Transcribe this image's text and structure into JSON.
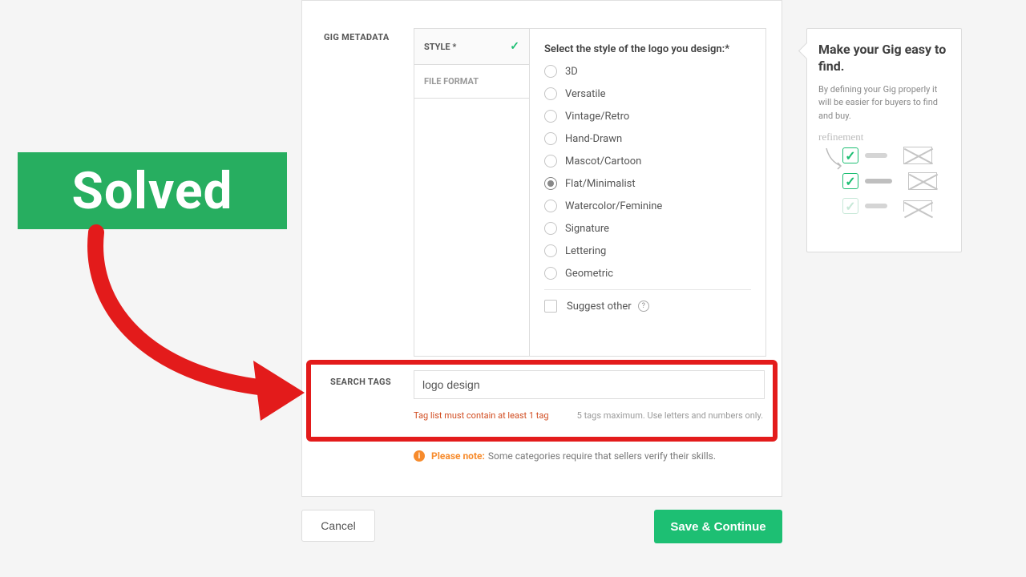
{
  "overlay": {
    "badge": "Solved"
  },
  "sections": {
    "gig_metadata": "GIG METADATA",
    "search_tags": "SEARCH TAGS"
  },
  "metadata": {
    "tabs": {
      "style": "STYLE *",
      "file_format": "FILE FORMAT"
    },
    "prompt": "Select the style of the logo you design:*",
    "options": [
      "3D",
      "Versatile",
      "Vintage/Retro",
      "Hand-Drawn",
      "Mascot/Cartoon",
      "Flat/Minimalist",
      "Watercolor/Feminine",
      "Signature",
      "Lettering",
      "Geometric"
    ],
    "selected_index": 5,
    "suggest_other": "Suggest other"
  },
  "search_tags": {
    "input_value": "logo design",
    "error": "Tag list must contain at least 1 tag",
    "hint": "5 tags maximum. Use letters and numbers only."
  },
  "note": {
    "label": "Please note:",
    "text": "Some categories require that sellers verify their skills."
  },
  "buttons": {
    "cancel": "Cancel",
    "save": "Save & Continue"
  },
  "tip": {
    "title": "Make your Gig easy to find.",
    "body": "By defining your Gig properly it will be easier for buyers to find and buy.",
    "refinement": "refinement"
  }
}
